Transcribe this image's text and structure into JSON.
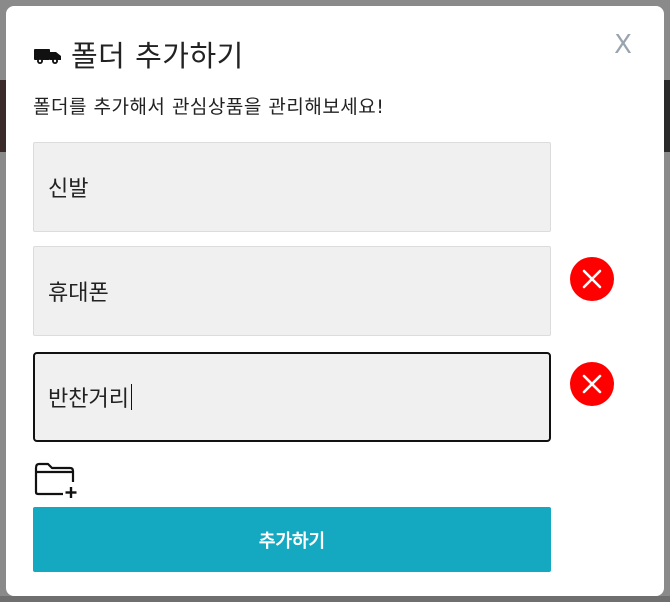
{
  "dialog": {
    "title": "폴더 추가하기",
    "close_label": "X",
    "subtitle": "폴더를 추가해서 관심상품을 관리해보세요!",
    "folders": [
      {
        "value": "신발",
        "removable": false,
        "focused": false
      },
      {
        "value": "휴대폰",
        "removable": true,
        "focused": false
      },
      {
        "value": "반찬거리",
        "removable": true,
        "focused": true
      }
    ],
    "icons": {
      "title": "truck-icon",
      "remove": "remove-circle-x-icon",
      "add_folder": "folder-plus-icon"
    },
    "submit_label": "추가하기"
  },
  "colors": {
    "accent": "#15a8c1",
    "remove": "#ff0000",
    "input_bg": "#f0f0f0",
    "close": "#9aa4b1"
  }
}
